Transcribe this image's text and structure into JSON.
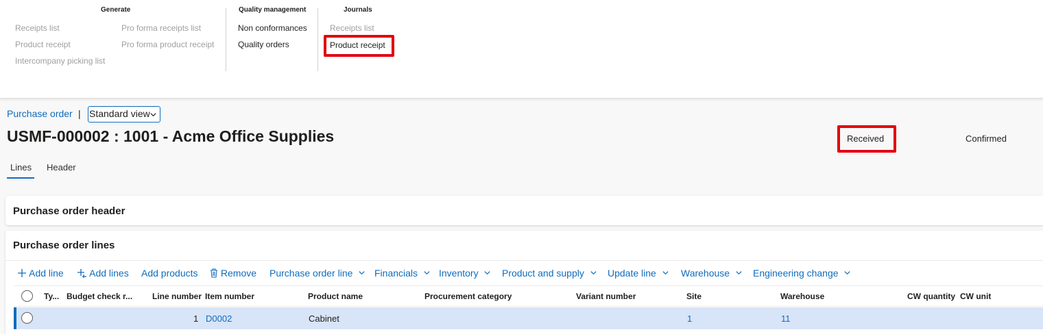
{
  "ribbon": {
    "groups": {
      "generate": {
        "title": "Generate",
        "col1": [
          "Receipts list",
          "Product receipt",
          "Intercompany picking list"
        ],
        "col2": [
          "Pro forma receipts list",
          "Pro forma product receipt"
        ]
      },
      "quality": {
        "title": "Quality management",
        "items": [
          "Non conformances",
          "Quality orders"
        ]
      },
      "journals": {
        "title": "Journals",
        "items": [
          "Receipts list",
          "Product receipt"
        ]
      }
    }
  },
  "header": {
    "breadcrumb": "Purchase order",
    "separator": "|",
    "view": "Standard view",
    "title": "USMF-000002 : 1001 - Acme Office Supplies",
    "status_received": "Received",
    "status_confirmed": "Confirmed"
  },
  "tabs": [
    "Lines",
    "Header"
  ],
  "sections": {
    "po_header": "Purchase order header",
    "po_lines": "Purchase order lines"
  },
  "toolbar": {
    "add_line": "Add line",
    "add_lines": "Add lines",
    "add_products": "Add products",
    "remove": "Remove",
    "menus": [
      "Purchase order line",
      "Financials",
      "Inventory",
      "Product and supply",
      "Update line",
      "Warehouse",
      "Engineering change"
    ]
  },
  "grid": {
    "columns": [
      "Ty...",
      "Budget check r...",
      "Line number",
      "Item number",
      "Product name",
      "Procurement category",
      "Variant number",
      "Site",
      "Warehouse",
      "CW quantity",
      "CW unit"
    ],
    "rows": [
      {
        "line_number": "1",
        "item_number": "D0002",
        "product_name": "Cabinet",
        "site": "1",
        "warehouse": "11"
      }
    ]
  },
  "colors": {
    "accent": "#0f6cbd",
    "highlight": "#e3000f",
    "selected_row": "#d8e4f7"
  }
}
